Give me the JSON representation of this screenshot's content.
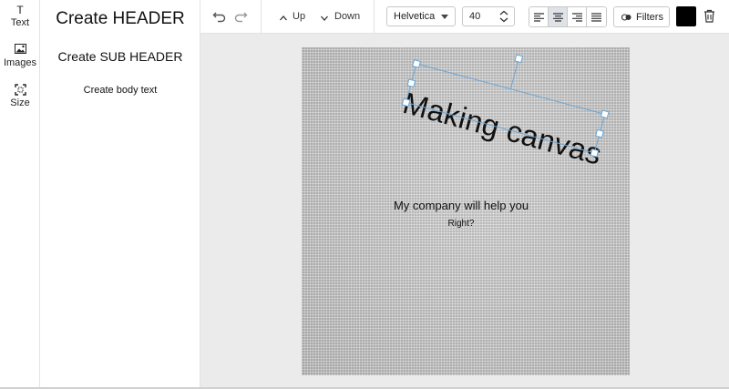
{
  "sidebar": {
    "items": [
      {
        "label": "Text",
        "icon": "text-icon"
      },
      {
        "label": "Images",
        "icon": "image-icon"
      },
      {
        "label": "Size",
        "icon": "resize-icon"
      }
    ]
  },
  "text_panel": {
    "header_option": "Create HEADER",
    "subheader_option": "Create SUB HEADER",
    "body_option": "Create body text"
  },
  "toolbar": {
    "undo_icon": "undo-icon",
    "redo_icon": "redo-icon",
    "up_label": "Up",
    "down_label": "Down",
    "font_family": "Helvetica",
    "font_size": "40",
    "align_options": [
      "align-left",
      "align-center",
      "align-right",
      "align-justify"
    ],
    "active_align": "align-center",
    "filters_label": "Filters",
    "color": "#000000",
    "delete_icon": "trash-icon"
  },
  "canvas": {
    "title_text": "Making canvas",
    "line1": "My company will help you",
    "line2": "Right?"
  },
  "colors": {
    "selection": "#6aa6d6",
    "active_button": "#dfe3e8",
    "border": "#c8c8c8"
  }
}
